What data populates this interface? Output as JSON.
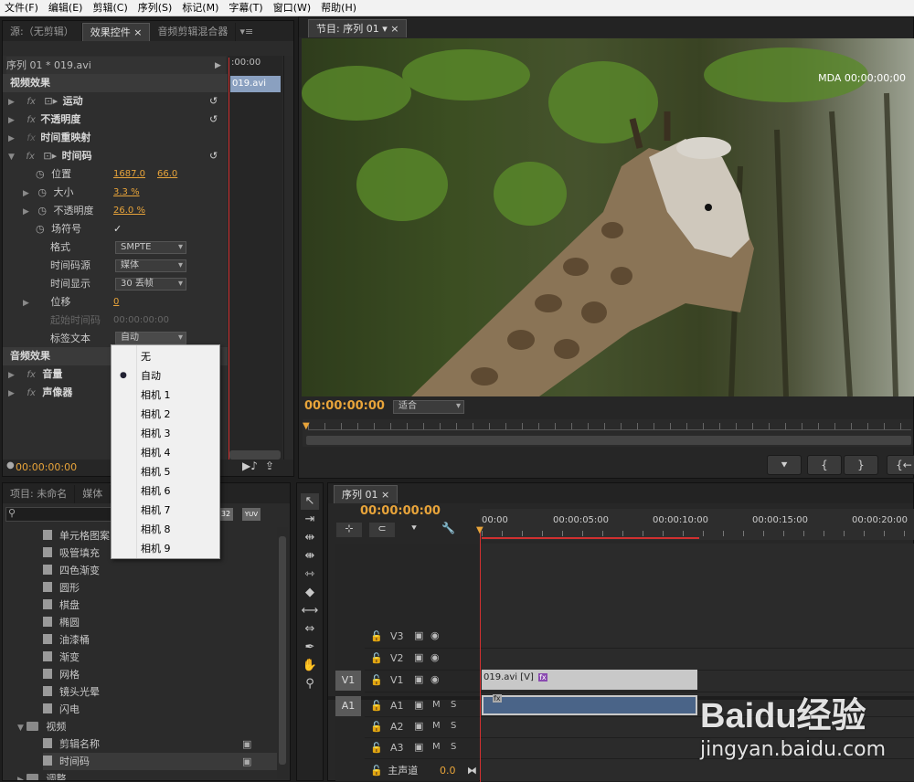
{
  "menubar": [
    "文件(F)",
    "编辑(E)",
    "剪辑(C)",
    "序列(S)",
    "标记(M)",
    "字幕(T)",
    "窗口(W)",
    "帮助(H)"
  ],
  "source_panel": {
    "tabs": [
      "源:（无剪辑）",
      "效果控件",
      "音频剪辑混合器"
    ],
    "sequence_label": "序列 01 * 019.avi",
    "mini_ruler": ":00:00",
    "clip_label": "019.avi",
    "video_effects": "视频效果",
    "motion": "运动",
    "opacity": "不透明度",
    "time_remap": "时间重映射",
    "timecode_fx": "时间码",
    "position_label": "位置",
    "position_x": "1687.0",
    "position_y": "66.0",
    "size_label": "大小",
    "size_value": "3.3 %",
    "opacity2_label": "不透明度",
    "opacity2_value": "26.0 %",
    "field_symbol_label": "场符号",
    "format_label": "格式",
    "format_value": "SMPTE",
    "tc_source_label": "时间码源",
    "tc_source_value": "媒体",
    "tc_display_label": "时间显示",
    "tc_display_value": "30 丢帧",
    "offset_label": "位移",
    "offset_value": "0",
    "start_tc_label": "起始时间码",
    "start_tc_value": "00:00:00:00",
    "label_text_label": "标签文本",
    "label_text_value": "自动",
    "audio_effects": "音频效果",
    "volume": "音量",
    "panner": "声像器",
    "footer_tc": "00:00:00:00"
  },
  "label_menu": {
    "items": [
      "无",
      "自动",
      "相机 1",
      "相机 2",
      "相机 3",
      "相机 4",
      "相机 5",
      "相机 6",
      "相机 7",
      "相机 8",
      "相机 9"
    ],
    "selected": "自动"
  },
  "program_panel": {
    "tab": "节目: 序列 01",
    "overlay": "MDA 00;00;00;00",
    "timecode": "00:00:00:00",
    "fit_value": "适合"
  },
  "project_panel": {
    "tabs": [
      "项目: 未命名",
      "媒体",
      "效果"
    ],
    "items": [
      "单元格图案",
      "吸管填充",
      "四色渐变",
      "圆形",
      "棋盘",
      "椭圆",
      "油漆桶",
      "渐变",
      "网格",
      "镜头光晕",
      "闪电"
    ],
    "folder_video": "视频",
    "sub_items": [
      "剪辑名称",
      "时间码"
    ],
    "folder_adjust": "调整"
  },
  "timeline": {
    "tab": "序列 01",
    "timecode": "00:00:00:00",
    "ruler": [
      "00:00",
      "00:00:05:00",
      "00:00:10:00",
      "00:00:15:00",
      "00:00:20:00"
    ],
    "video_tracks": [
      "V3",
      "V2",
      "V1"
    ],
    "audio_tracks": [
      "A1",
      "A2",
      "A3"
    ],
    "src_v": "V1",
    "src_a": "A1",
    "clip_video": "019.avi [V]",
    "master_label": "主声道",
    "master_value": "0.0",
    "m_label": "M",
    "s_label": "S"
  },
  "watermark": {
    "brand": "Baidu经验",
    "url": "jingyan.baidu.com"
  },
  "colors": {
    "accent_orange": "#e8a43a",
    "playhead": "#d03030",
    "clip_blue": "#4a6488",
    "clip_video": "#c8c8c8"
  }
}
